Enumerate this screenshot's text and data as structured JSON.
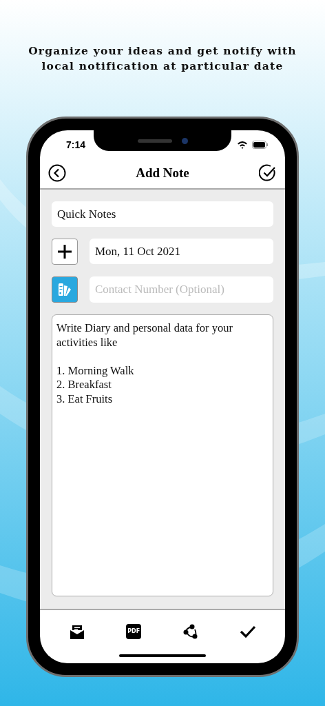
{
  "headline": [
    "Organize your ideas and get notify with",
    "local notification at particular date"
  ],
  "status_bar": {
    "time": "7:14"
  },
  "nav": {
    "title": "Add Note"
  },
  "title_field": {
    "value": "Quick Notes"
  },
  "date_field": {
    "value": "Mon, 11 Oct 2021"
  },
  "contact_field": {
    "placeholder": "Contact Number (Optional)"
  },
  "note": {
    "value": "Write Diary and personal data for your activities like\n\n1. Morning Walk\n2. Breakfast\n3. Eat Fruits"
  },
  "toolbar": [
    {
      "kind": "mail"
    },
    {
      "kind": "pdf",
      "label": "PDF"
    },
    {
      "kind": "share"
    },
    {
      "kind": "check"
    }
  ]
}
